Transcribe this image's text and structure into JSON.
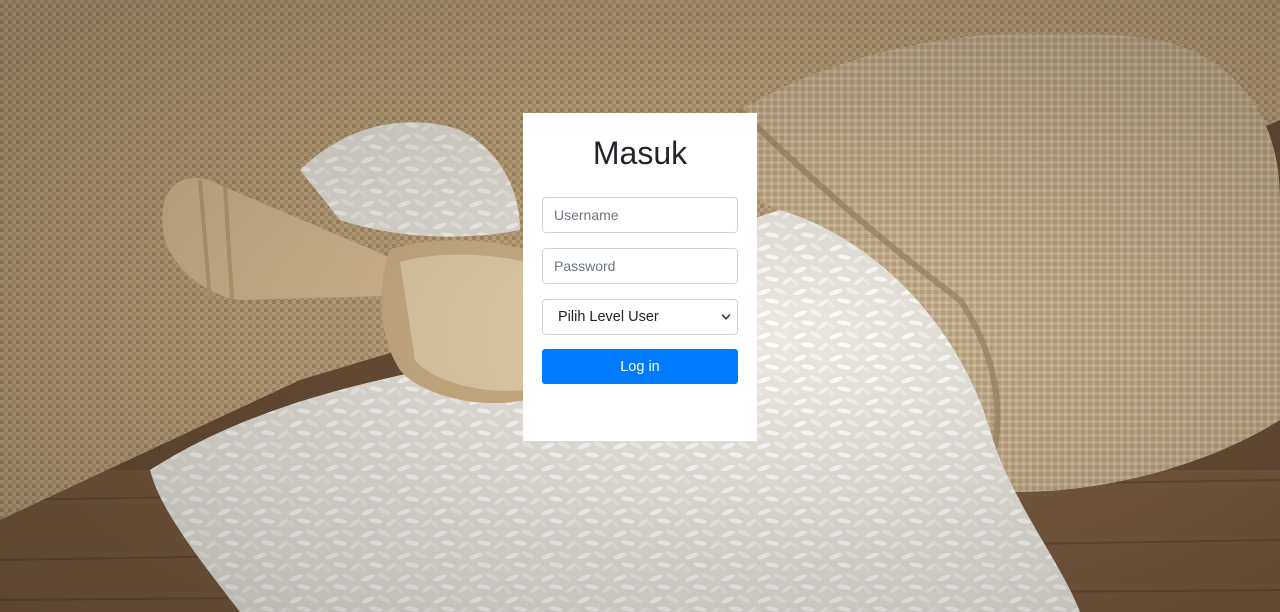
{
  "login": {
    "title": "Masuk",
    "username_placeholder": "Username",
    "password_placeholder": "Password",
    "level_select_value": "Pilih Level User",
    "submit_label": "Log in"
  },
  "colors": {
    "primary_button": "#007bff",
    "card_background": "#ffffff"
  },
  "icons": {
    "select_arrow": "chevron-down-icon"
  }
}
